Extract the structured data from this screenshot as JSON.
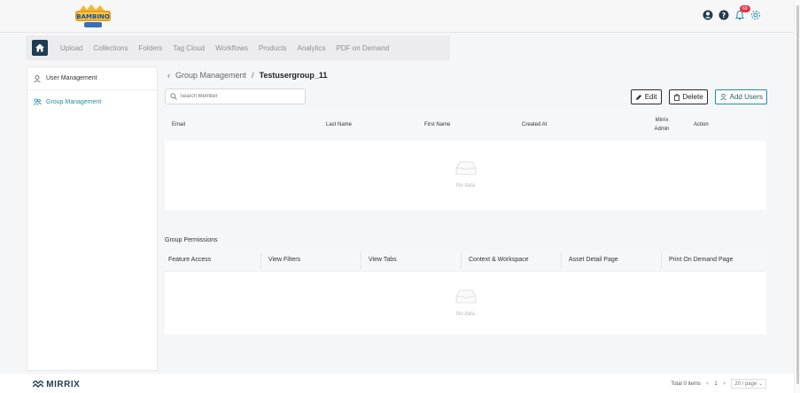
{
  "header": {
    "logo_alt": "Bambino",
    "notification_count": "69",
    "icons": [
      "user-icon",
      "help-icon",
      "bell-icon",
      "gear-icon"
    ]
  },
  "nav": {
    "items": [
      "Upload",
      "Collections",
      "Folders",
      "Tag Cloud",
      "Workflows",
      "Products",
      "Analytics",
      "PDF on Demand"
    ]
  },
  "sidebar": {
    "items": [
      {
        "label": "User Management",
        "active": false
      },
      {
        "label": "Group Management",
        "active": true
      }
    ]
  },
  "breadcrumb": {
    "parent": "Group Management",
    "separator": "/",
    "current": "Testusergroup_11"
  },
  "search": {
    "placeholder": "Search Member"
  },
  "toolbar": {
    "edit_label": "Edit",
    "delete_label": "Delete",
    "add_users_label": "Add Users"
  },
  "members_table": {
    "columns": [
      "Email",
      "Last Name",
      "First Name",
      "Created At",
      "Mirrix Admin",
      "Action"
    ],
    "empty_text": "No data"
  },
  "permissions": {
    "title": "Group Permissions",
    "columns": [
      "Feature Access",
      "View Filters",
      "View Tabs",
      "Context & Workspace",
      "Asset Detail Page",
      "Print On Demand Page"
    ],
    "empty_text": "No data"
  },
  "footer": {
    "brand": "MIRRIX",
    "total_text": "Total 0 items",
    "current_page": "1",
    "page_size": "20 / page"
  },
  "colors": {
    "accent": "#1f8ea3",
    "brand_dark": "#1f3c53",
    "badge": "#e5344c"
  }
}
